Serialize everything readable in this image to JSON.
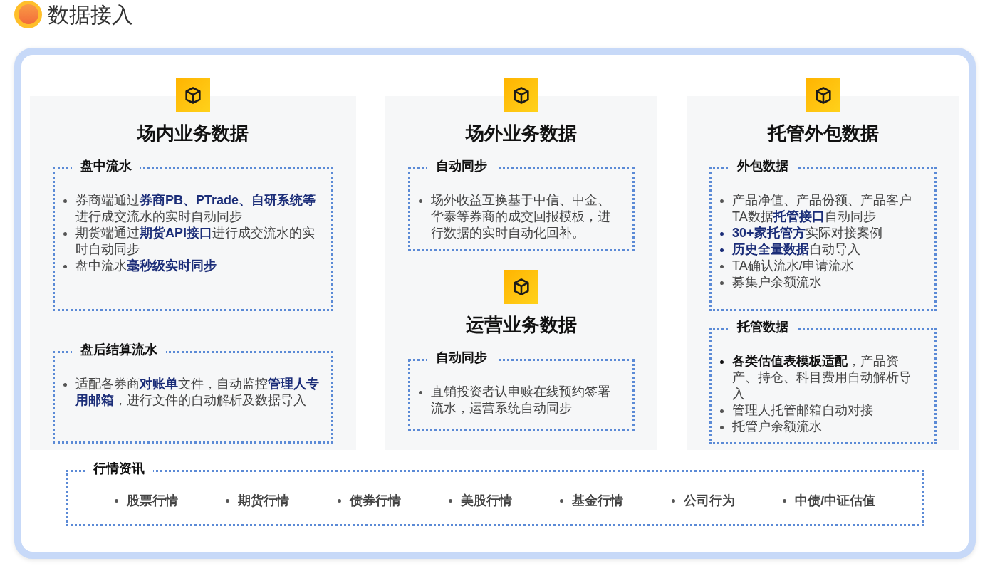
{
  "header": {
    "title": "数据接入"
  },
  "columns": [
    {
      "groups": [
        {
          "title": "场内业务数据",
          "sections": [
            {
              "label": "盘中流水",
              "bullets": [
                {
                  "kind": "plain",
                  "text": "券商端通过**券商PB、PTrade、自研系统等**进行成交流水的实时自动同步"
                },
                {
                  "kind": "plain",
                  "text": "期货端通过**期货API接口**进行成交流水的实时自动同步"
                },
                {
                  "kind": "plain",
                  "text": "盘中流水**毫秒级实时同步**"
                }
              ]
            },
            {
              "label": "盘后结算流水",
              "bullets": [
                {
                  "kind": "plain",
                  "text": "适配各券商**对账单**文件，自动监控**管理人专用邮箱**，进行文件的自动解析及数据导入"
                }
              ]
            }
          ]
        }
      ]
    },
    {
      "groups": [
        {
          "title": "场外业务数据",
          "sections": [
            {
              "label": "自动同步",
              "bullets": [
                {
                  "kind": "plain",
                  "text": "场外收益互换基于中信、中金、华泰等券商的成交回报模板，进行数据的实时自动化回补。"
                }
              ]
            }
          ]
        },
        {
          "title": "运营业务数据",
          "sections": [
            {
              "label": "自动同步",
              "bullets": [
                {
                  "kind": "plain",
                  "text": "直销投资者认申赎在线预约签署流水，运营系统自动同步"
                }
              ]
            }
          ]
        }
      ]
    },
    {
      "groups": [
        {
          "title": "托管外包数据",
          "sections": [
            {
              "label": "外包数据",
              "bullets": [
                {
                  "kind": "plain",
                  "text": "产品净值、产品份额、产品客户TA数据**托管接口**自动同步"
                },
                {
                  "kind": "lead",
                  "text": "**30+家托管方**实际对接案例"
                },
                {
                  "kind": "lead",
                  "text": "**历史全量数据**自动导入"
                },
                {
                  "kind": "plain",
                  "text": "TA确认流水/申请流水"
                },
                {
                  "kind": "plain",
                  "text": "募集户余额流水"
                }
              ]
            },
            {
              "label": "托管数据",
              "bullets": [
                {
                  "kind": "dark",
                  "text": "**各类估值表模板适配**，产品资产、持仓、科目费用自动解析导入"
                },
                {
                  "kind": "plain",
                  "text": "管理人托管邮箱自动对接"
                },
                {
                  "kind": "plain",
                  "text": "托管户余额流水"
                }
              ]
            }
          ]
        }
      ]
    }
  ],
  "market": {
    "label": "行情资讯",
    "items": [
      "股票行情",
      "期货行情",
      "债券行情",
      "美股行情",
      "基金行情",
      "公司行为",
      "中债/中证估值"
    ]
  }
}
